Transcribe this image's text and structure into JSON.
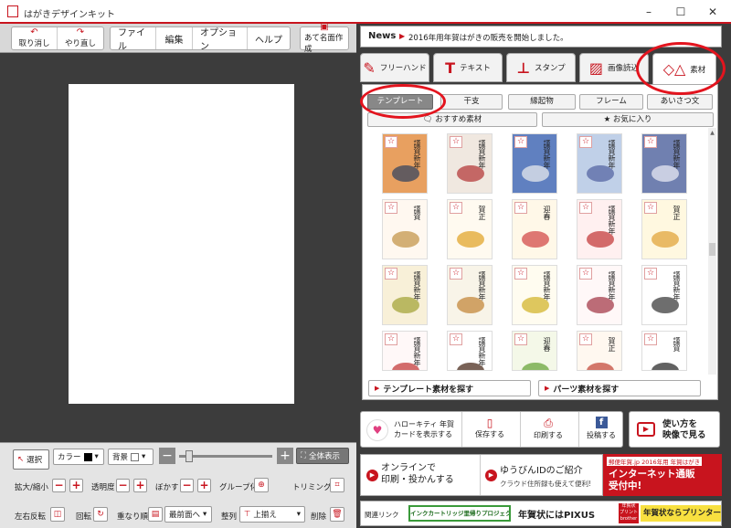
{
  "window": {
    "title": "はがきデザインキット",
    "controls": [
      "–",
      "☐",
      "✕"
    ]
  },
  "toolbar": {
    "undo": "取り消し",
    "redo": "やり直し",
    "menus": [
      "ファイル",
      "編集",
      "オプション",
      "ヘルプ"
    ],
    "address": "あて名面作成"
  },
  "news": {
    "label": "News",
    "text": "2016年用年賀はがきの販売を開始しました。"
  },
  "tabs": [
    {
      "label": "フリーハンド",
      "icon": "pencil-icon"
    },
    {
      "label": "テキスト",
      "icon": "text-t-icon"
    },
    {
      "label": "スタンプ",
      "icon": "stamp-icon"
    },
    {
      "label": "画像読込",
      "icon": "image-icon"
    },
    {
      "label": "素材",
      "icon": "shapes-icon"
    }
  ],
  "categories": [
    "テンプレート",
    "干支",
    "縁起物",
    "フレーム",
    "あいさつ文"
  ],
  "favorites": {
    "recommended": "おすすめ素材",
    "favorites": "お気に入り"
  },
  "thumbs": [
    {
      "bg": "#e8a060",
      "accent": "#2c3e60",
      "text": "謹賀新年"
    },
    {
      "bg": "#f0e8e0",
      "accent": "#b03030",
      "text": "謹賀新年"
    },
    {
      "bg": "#6080c0",
      "accent": "#f0f0f0",
      "text": "謹賀新年"
    },
    {
      "bg": "#c0d0e8",
      "accent": "#5060a0",
      "text": "謹賀新年"
    },
    {
      "bg": "#7080b0",
      "accent": "#f0f0f8",
      "text": "謹賀新年"
    },
    {
      "bg": "#fff8f0",
      "accent": "#c09040",
      "text": "謹賀"
    },
    {
      "bg": "#fffaf0",
      "accent": "#e0a020",
      "text": "賀正"
    },
    {
      "bg": "#fff8e8",
      "accent": "#d04040",
      "text": "迎春"
    },
    {
      "bg": "#fff0f0",
      "accent": "#c03030",
      "text": "謹賀新年"
    },
    {
      "bg": "#fff8e0",
      "accent": "#e0a030",
      "text": "賀正"
    },
    {
      "bg": "#f8f0d8",
      "accent": "#a0a030",
      "text": "謹賀新年"
    },
    {
      "bg": "#f8f4e8",
      "accent": "#c08030",
      "text": "謹賀新年"
    },
    {
      "bg": "#fffcf0",
      "accent": "#d0b020",
      "text": "謹賀新年"
    },
    {
      "bg": "#fff8f8",
      "accent": "#a03040",
      "text": "謹賀新年"
    },
    {
      "bg": "#fff",
      "accent": "#303030",
      "text": "謹賀新年"
    },
    {
      "bg": "#fff8f8",
      "accent": "#c03030",
      "text": "謹賀新年"
    },
    {
      "bg": "#fff",
      "accent": "#402010",
      "text": "謹賀新年"
    },
    {
      "bg": "#f4f8e8",
      "accent": "#60a030",
      "text": "迎春"
    },
    {
      "bg": "#fff8f0",
      "accent": "#c04030",
      "text": "賀正"
    },
    {
      "bg": "#fff",
      "accent": "#202020",
      "text": "謹賀"
    }
  ],
  "search": {
    "template": "テンプレート素材を探す",
    "parts": "パーツ素材を探す"
  },
  "bottom": {
    "select": "選択",
    "color": "カラー",
    "background": "背景",
    "show_all": "全体表示",
    "zoom": "拡大/縮小",
    "transparency": "透明度",
    "blur": "ぼかす",
    "group": "グループ化",
    "trim": "トリミング",
    "flip": "左右反転",
    "rotate": "回転",
    "order": "重なり順",
    "front": "最前面へ",
    "align": "整列",
    "align_top": "上揃え",
    "delete": "削除"
  },
  "actions": {
    "kitty": "ハローキティ 年賀\nカードを表示する",
    "save": "保存する",
    "print": "印刷する",
    "post": "投稿する",
    "video": "使い方を\n映像で見る"
  },
  "promo": {
    "online": "オンラインで\n印刷・投かんする",
    "yubin_title": "ゆうびんIDのご紹介",
    "yubin_sub": "クラウド住所録も使えて便利!",
    "ad_top": "郵便年賀.jp 2016年用 年賀はがき",
    "ad_main": "インターネット通販\n受付中!"
  },
  "links": {
    "label": "関連リンク",
    "ink": "インクカートリッジ里帰りプロジェクト",
    "pixus": "年賀状にはPIXUS",
    "brother": "年賀状ならプリンター"
  }
}
